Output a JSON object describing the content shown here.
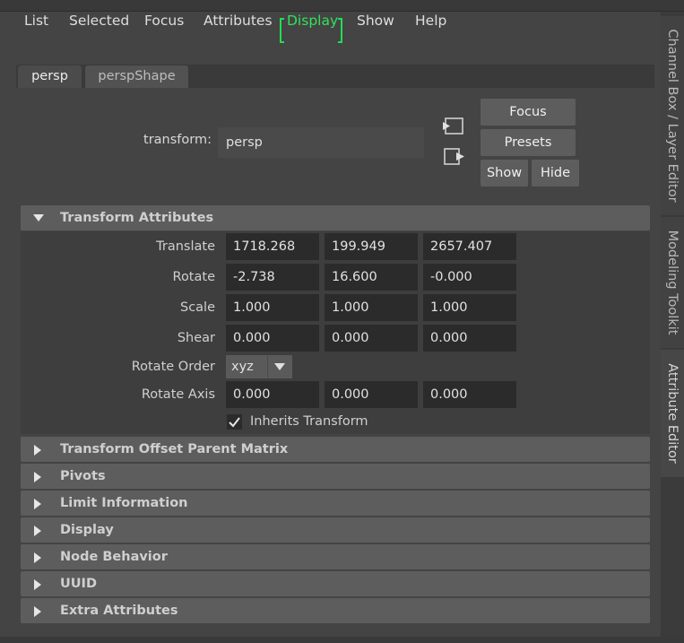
{
  "menu": {
    "items": [
      "List",
      "Selected",
      "Focus",
      "Attributes",
      "Display",
      "Show",
      "Help"
    ],
    "active": "Display"
  },
  "tabs": [
    {
      "label": "persp",
      "active": true
    },
    {
      "label": "perspShape",
      "active": false
    }
  ],
  "node": {
    "label": "transform:",
    "value": "persp",
    "icons": [
      "load-node-icon",
      "select-node-icon"
    ],
    "buttons": {
      "focus": "Focus",
      "presets": "Presets",
      "show": "Show",
      "hide": "Hide"
    }
  },
  "transform_attributes": {
    "title": "Transform Attributes",
    "expanded": true,
    "rows": [
      {
        "label": "Translate",
        "values": [
          "1718.268",
          "199.949",
          "2657.407"
        ]
      },
      {
        "label": "Rotate",
        "values": [
          "-2.738",
          "16.600",
          "-0.000"
        ]
      },
      {
        "label": "Scale",
        "values": [
          "1.000",
          "1.000",
          "1.000"
        ]
      },
      {
        "label": "Shear",
        "values": [
          "0.000",
          "0.000",
          "0.000"
        ]
      }
    ],
    "rotate_order": {
      "label": "Rotate Order",
      "value": "xyz"
    },
    "rotate_axis": {
      "label": "Rotate Axis",
      "values": [
        "0.000",
        "0.000",
        "0.000"
      ]
    },
    "inherits_transform": {
      "label": "Inherits Transform",
      "checked": true
    }
  },
  "collapsed_sections": [
    "Transform Offset Parent Matrix",
    "Pivots",
    "Limit Information",
    "Display",
    "Node Behavior",
    "UUID",
    "Extra Attributes"
  ],
  "side_tabs": [
    {
      "label": "Channel Box / Layer Editor",
      "active": false
    },
    {
      "label": "Modeling Toolkit",
      "active": false
    },
    {
      "label": "Attribute Editor",
      "active": true
    }
  ],
  "colors": {
    "background": "#444444",
    "menu_active": "#33e15a",
    "section_header": "#5d5d5d",
    "field": "#2b2b2b"
  }
}
